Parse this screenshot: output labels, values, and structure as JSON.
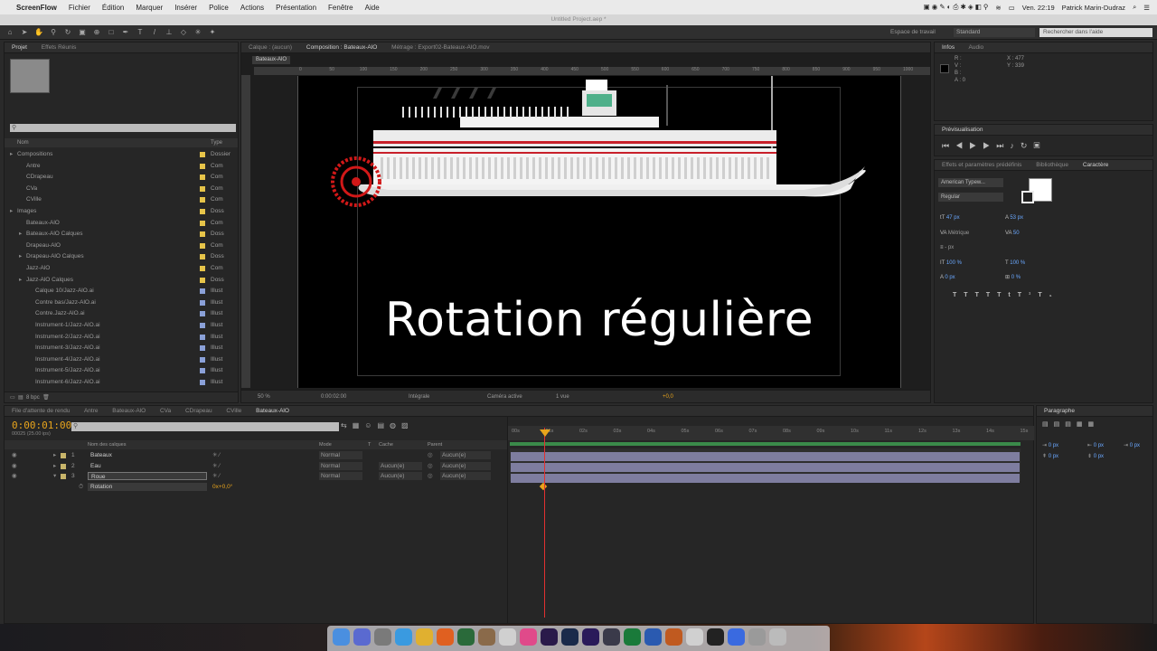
{
  "menubar": {
    "app": "ScreenFlow",
    "items": [
      "Fichier",
      "Édition",
      "Marquer",
      "Insérer",
      "Police",
      "Actions",
      "Présentation",
      "Fenêtre",
      "Aide"
    ],
    "clock": "Ven. 22:19",
    "user": "Patrick Marin-Dudraz"
  },
  "titlebar": {
    "text": "Untitled Project.aep *"
  },
  "toolbar": {
    "workspace_label": "Espace de travail",
    "workspace_value": "Standard",
    "search_placeholder": "Rechercher dans l'aide"
  },
  "project_panel": {
    "tabs": [
      "Projet",
      "Effets Réunis"
    ],
    "search_placeholder": "",
    "col_name": "Nom",
    "col_type": "Type",
    "items": [
      {
        "label": "Compositions",
        "type": "Dossier",
        "color": "#e6c449",
        "indent": 0
      },
      {
        "label": "Antre",
        "type": "Com",
        "color": "#e6c449",
        "indent": 1
      },
      {
        "label": "CDrapeau",
        "type": "Com",
        "color": "#e6c449",
        "indent": 1
      },
      {
        "label": "CVa",
        "type": "Com",
        "color": "#e6c449",
        "indent": 1
      },
      {
        "label": "CVille",
        "type": "Com",
        "color": "#e6c449",
        "indent": 1
      },
      {
        "label": "Images",
        "type": "Doss",
        "color": "#e6c449",
        "indent": 0
      },
      {
        "label": "Bateaux-AlO",
        "type": "Com",
        "color": "#e6c449",
        "indent": 1
      },
      {
        "label": "Bateaux-AlO Calques",
        "type": "Doss",
        "color": "#e6c449",
        "indent": 1
      },
      {
        "label": "Drapeau-AlO",
        "type": "Com",
        "color": "#e6c449",
        "indent": 1
      },
      {
        "label": "Drapeau-AlO Calques",
        "type": "Doss",
        "color": "#e6c449",
        "indent": 1
      },
      {
        "label": "Jazz-AlO",
        "type": "Com",
        "color": "#e6c449",
        "indent": 1
      },
      {
        "label": "Jazz-AlO Calques",
        "type": "Doss",
        "color": "#e6c449",
        "indent": 1
      },
      {
        "label": "Calque 10/Jazz-AlO.ai",
        "type": "Illust",
        "color": "#8aa0d8",
        "indent": 2
      },
      {
        "label": "Contre bas/Jazz-AlO.ai",
        "type": "Illust",
        "color": "#8aa0d8",
        "indent": 2
      },
      {
        "label": "Contre.Jazz-AlO.ai",
        "type": "Illust",
        "color": "#8aa0d8",
        "indent": 2
      },
      {
        "label": "Instrument-1/Jazz-AlO.ai",
        "type": "Illust",
        "color": "#8aa0d8",
        "indent": 2
      },
      {
        "label": "Instrument-2/Jazz-AlO.ai",
        "type": "Illust",
        "color": "#8aa0d8",
        "indent": 2
      },
      {
        "label": "Instrument-3/Jazz-AlO.ai",
        "type": "Illust",
        "color": "#8aa0d8",
        "indent": 2
      },
      {
        "label": "Instrument-4/Jazz-AlO.ai",
        "type": "Illust",
        "color": "#8aa0d8",
        "indent": 2
      },
      {
        "label": "Instrument-5/Jazz-AlO.ai",
        "type": "Illust",
        "color": "#8aa0d8",
        "indent": 2
      },
      {
        "label": "Instrument-6/Jazz-AlO.ai",
        "type": "Illust",
        "color": "#8aa0d8",
        "indent": 2
      }
    ],
    "footer_bpc": "8 bpc"
  },
  "composition_panel": {
    "tabs": [
      "Calque : (aucun)",
      "Composition : Bateaux-AlO",
      "Métrage : Export02-Bateaux-AlO.mov"
    ],
    "comp_name": "Bateaux-AlO",
    "overlay_text": "Rotation régulière",
    "ruler_labels": [
      "0",
      "50",
      "100",
      "150",
      "200",
      "250",
      "300",
      "350",
      "400",
      "450",
      "500",
      "550",
      "600",
      "650",
      "700",
      "750",
      "800",
      "850",
      "900",
      "950",
      "1000"
    ],
    "footer": {
      "zoom": "50 %",
      "timecode": "0:00:02:00",
      "resolution": "Intégrale",
      "camera": "Caméra active",
      "views": "1 vue",
      "exposure": "+0,0"
    }
  },
  "info_panel": {
    "tabs": [
      "Infos",
      "Audio"
    ],
    "r": "R :",
    "g": "V :",
    "b": "B :",
    "a": "A : 0",
    "x": "X : 477",
    "y": "Y : 339"
  },
  "preview_panel": {
    "title": "Prévisualisation"
  },
  "effects_panel": {
    "tabs": [
      "Effets et paramètres prédéfinis",
      "Bibliothèque",
      "Caractère"
    ]
  },
  "character_panel": {
    "font": "American Typew...",
    "style": "Regular",
    "size": "47 px",
    "leading": "53 px",
    "tracking": "50",
    "vert_scale": "100 %",
    "horiz_scale": "100 %",
    "baseline": "0 px",
    "tsume": "0 %",
    "kerning_label": "Métrique",
    "stroke": "- px"
  },
  "timeline_panel": {
    "tabs": [
      "File d'attente de rendu",
      "Antre",
      "Bateaux-AlO",
      "CVa",
      "CDrapeau",
      "CVille",
      "Bateaux-AlO"
    ],
    "timecode": "0:00:01:00",
    "fps": "00025 (25.00 ips)",
    "columns": {
      "name": "Nom des calques",
      "mode": "Mode",
      "track": "T",
      "cache": "Cache",
      "parent": "Parent"
    },
    "layers": [
      {
        "num": "1",
        "name": "Bateaux",
        "mode": "Normal",
        "cache": "",
        "parent": "Aucun(e)",
        "color": "#c8b56a"
      },
      {
        "num": "2",
        "name": "Eau",
        "mode": "Normal",
        "cache": "Aucun(e)",
        "parent": "Aucun(e)",
        "color": "#c8b56a"
      },
      {
        "num": "3",
        "name": "Roue",
        "mode": "Normal",
        "cache": "Aucun(e)",
        "parent": "Aucun(e)",
        "color": "#c8b56a"
      }
    ],
    "property": {
      "name": "Rotation",
      "value": "0x+0,0°"
    },
    "time_labels": [
      "00s",
      "01s",
      "02s",
      "03s",
      "04s",
      "05s",
      "06s",
      "07s",
      "08s",
      "09s",
      "10s",
      "11s",
      "12s",
      "13s",
      "14s",
      "15s"
    ]
  },
  "paragraph_panel": {
    "title": "Paragraphe",
    "values": [
      "0 px",
      "0 px",
      "0 px",
      "0 px",
      "0 px"
    ]
  },
  "colors": {
    "menubar": "#eaeaea",
    "panel": "#262626",
    "track": "#7e7d9f",
    "timeline_green": "#3a8a4a",
    "playhead": "#e23030",
    "accent": "#e8a41c",
    "wheel": "#d11818"
  }
}
